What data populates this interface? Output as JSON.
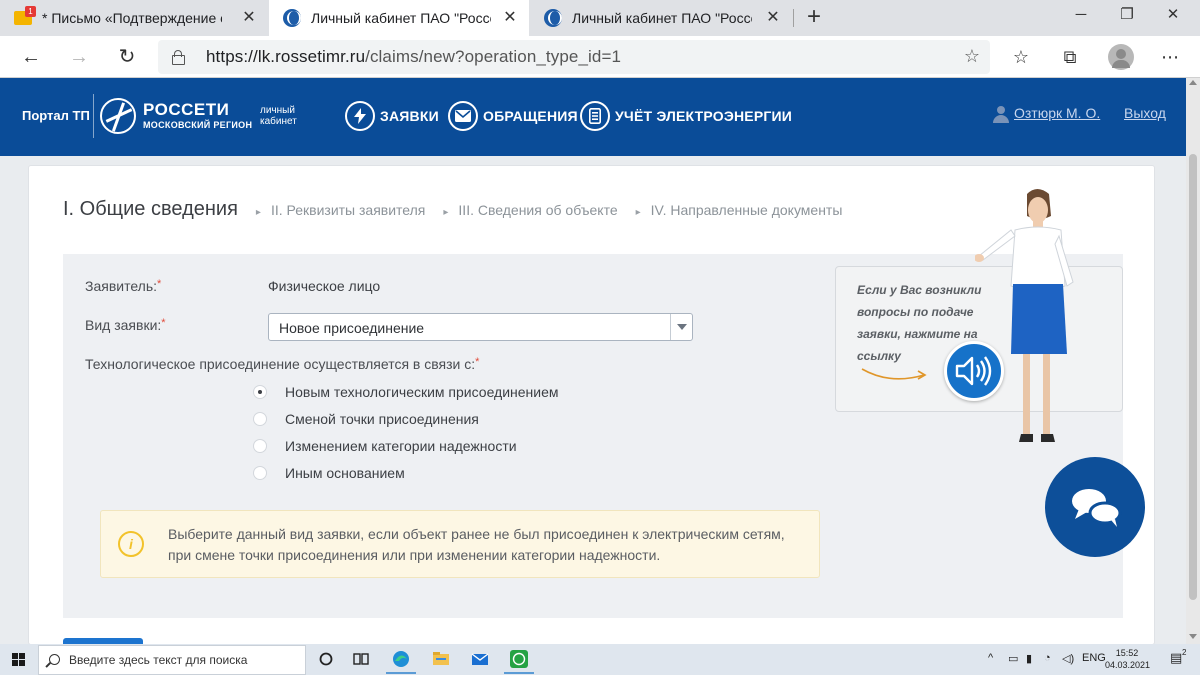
{
  "browser": {
    "tabs": [
      {
        "title": "* Письмо «Подтверждение e-m",
        "close": "✕"
      },
      {
        "title": "Личный кабинет ПАО \"Россети",
        "close": "✕"
      },
      {
        "title": "Личный кабинет ПАО \"Россети",
        "close": "✕"
      }
    ],
    "new_tab": "+",
    "window": {
      "minimize": "─",
      "restore": "❐",
      "close": "✕"
    },
    "nav": {
      "back": "←",
      "forward": "→",
      "reload": "↻"
    },
    "url_host": "https://lk.rossetimr.ru",
    "url_path": "/claims/new?operation_type_id=1"
  },
  "header": {
    "portal": "Портал ТП",
    "logo_name": "РОССЕТИ",
    "logo_region": "МОСКОВСКИЙ РЕГИОН",
    "lk_label_1": "личный",
    "lk_label_2": "кабинет",
    "menu": [
      {
        "label": "ЗАЯВКИ",
        "icon": "lightning-icon"
      },
      {
        "label": "ОБРАЩЕНИЯ",
        "icon": "envelope-icon"
      },
      {
        "label": "УЧЁТ ЭЛЕКТРОЭНЕРГИИ",
        "icon": "meter-icon"
      }
    ],
    "user_name": "Озтюрк М. О.",
    "logout": "Выход"
  },
  "steps": {
    "active": "I. Общие сведения",
    "items": [
      "II. Реквизиты заявителя",
      "III. Сведения об объекте",
      "IV. Направленные документы"
    ]
  },
  "form": {
    "applicant_label": "Заявитель:",
    "applicant_value": "Физическое лицо",
    "type_label": "Вид заявки:",
    "type_value": "Новое присоединение",
    "reason_label": "Технологическое присоединение осуществляется в связи с:",
    "required_mark": "*",
    "options": [
      {
        "label": "Новым технологическим присоединением",
        "checked": true
      },
      {
        "label": "Сменой точки присоединения",
        "checked": false
      },
      {
        "label": "Изменением категории надежности",
        "checked": false
      },
      {
        "label": "Иным основанием",
        "checked": false
      }
    ],
    "info_line_1": "Выберите данный вид заявки, если объект ранее не был присоединен к электрическим сетям,",
    "info_line_2": "при смене точки присоединения или при изменении категории надежности."
  },
  "help": {
    "text": "Если у Вас возникли вопросы по подаче заявки, нажмите на ссылку"
  },
  "taskbar": {
    "search_placeholder": "Введите здесь текст для поиска",
    "lang": "ENG",
    "time": "15:52",
    "date": "04.03.2021",
    "notification_count": "2"
  },
  "colors": {
    "header_bg": "#0a4c98",
    "chat_bg": "#0d4f99",
    "speaker_bg": "#1672c9",
    "info_bg": "#fdf7e4",
    "required": "#e04b3a"
  }
}
